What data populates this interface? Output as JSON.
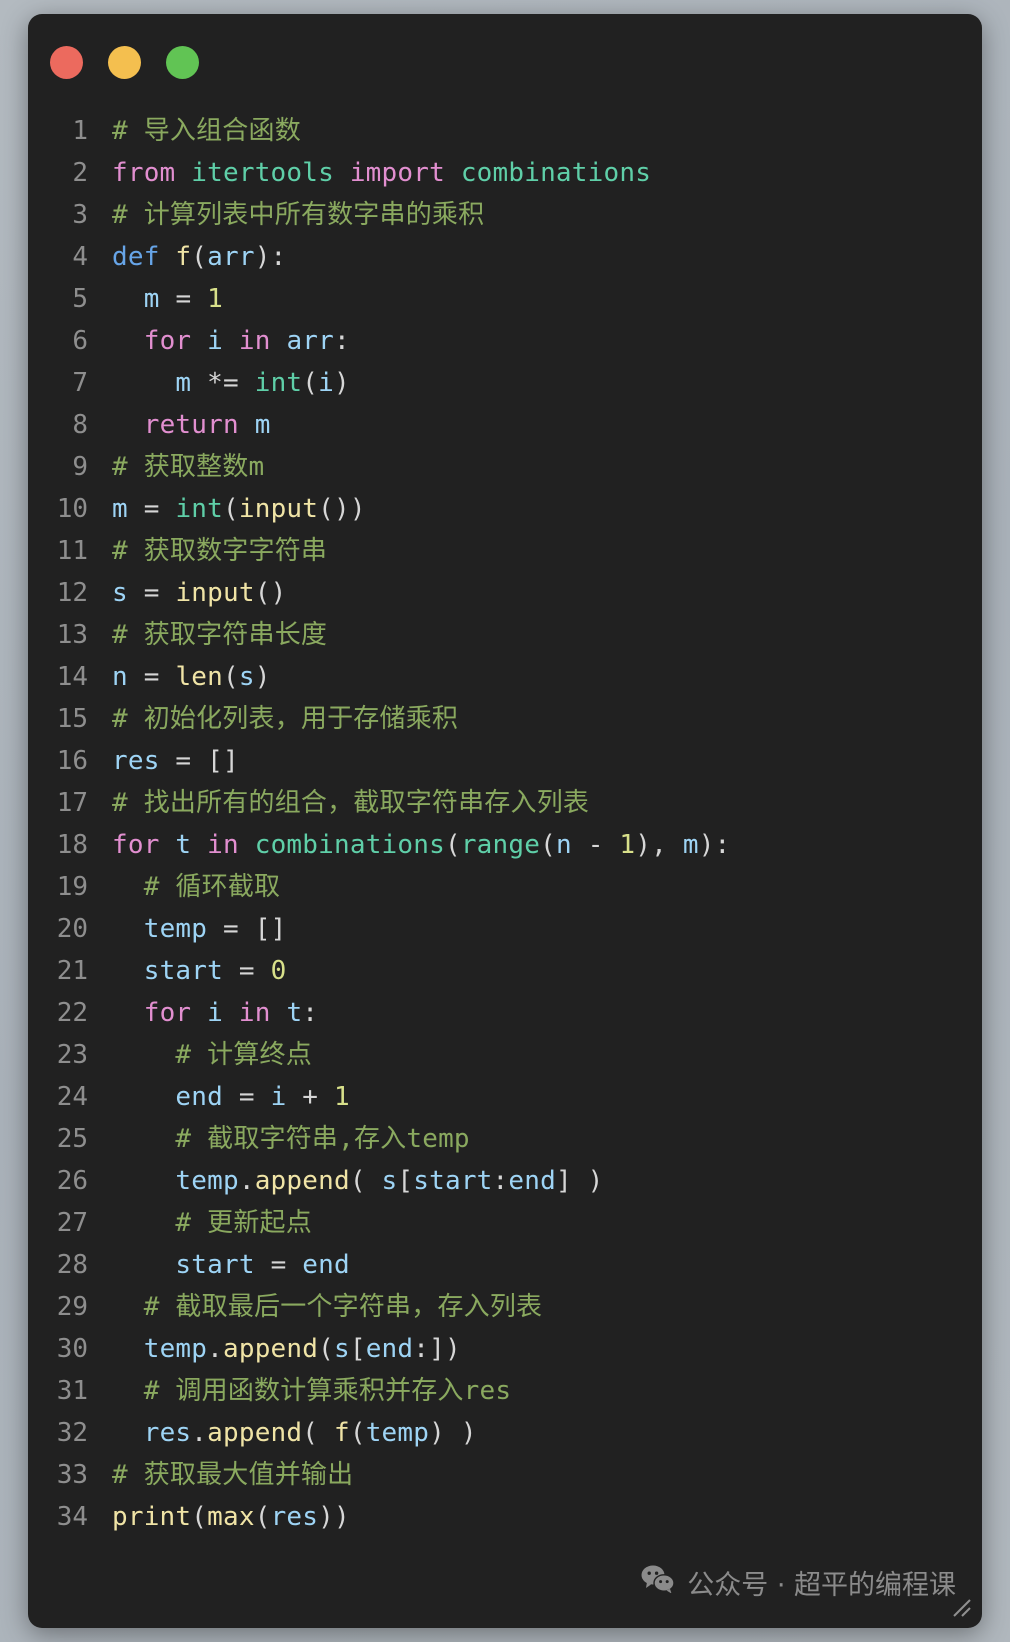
{
  "window": {
    "traffic_lights": [
      {
        "name": "close",
        "color": "#ec6a5e"
      },
      {
        "name": "minimize",
        "color": "#f4bf4f"
      },
      {
        "name": "maximize",
        "color": "#61c454"
      }
    ]
  },
  "editor": {
    "language": "python",
    "background": "#212121",
    "gutter_color": "#8e8e8e",
    "lines": [
      {
        "n": "1",
        "tokens": [
          {
            "t": "# 导入组合函数",
            "c": "t-com"
          }
        ]
      },
      {
        "n": "2",
        "tokens": [
          {
            "t": "from",
            "c": "t-kw"
          },
          {
            "t": " ",
            "c": "t-pun"
          },
          {
            "t": "itertools",
            "c": "t-mod"
          },
          {
            "t": " ",
            "c": "t-pun"
          },
          {
            "t": "import",
            "c": "t-kw"
          },
          {
            "t": " ",
            "c": "t-pun"
          },
          {
            "t": "combinations",
            "c": "t-mod"
          }
        ]
      },
      {
        "n": "3",
        "tokens": [
          {
            "t": "# 计算列表中所有数字串的乘积",
            "c": "t-com"
          }
        ]
      },
      {
        "n": "4",
        "tokens": [
          {
            "t": "def",
            "c": "t-def"
          },
          {
            "t": " ",
            "c": "t-pun"
          },
          {
            "t": "f",
            "c": "t-fn"
          },
          {
            "t": "(",
            "c": "t-pun"
          },
          {
            "t": "arr",
            "c": "t-var"
          },
          {
            "t": "):",
            "c": "t-pun"
          }
        ]
      },
      {
        "n": "5",
        "tokens": [
          {
            "t": "  ",
            "c": "t-pun"
          },
          {
            "t": "m",
            "c": "t-var"
          },
          {
            "t": " ",
            "c": "t-pun"
          },
          {
            "t": "=",
            "c": "t-op"
          },
          {
            "t": " ",
            "c": "t-pun"
          },
          {
            "t": "1",
            "c": "t-num"
          }
        ]
      },
      {
        "n": "6",
        "tokens": [
          {
            "t": "  ",
            "c": "t-pun"
          },
          {
            "t": "for",
            "c": "t-kw"
          },
          {
            "t": " ",
            "c": "t-pun"
          },
          {
            "t": "i",
            "c": "t-var"
          },
          {
            "t": " ",
            "c": "t-pun"
          },
          {
            "t": "in",
            "c": "t-kw"
          },
          {
            "t": " ",
            "c": "t-pun"
          },
          {
            "t": "arr",
            "c": "t-var"
          },
          {
            "t": ":",
            "c": "t-pun"
          }
        ]
      },
      {
        "n": "7",
        "tokens": [
          {
            "t": "    ",
            "c": "t-pun"
          },
          {
            "t": "m",
            "c": "t-var"
          },
          {
            "t": " ",
            "c": "t-pun"
          },
          {
            "t": "*=",
            "c": "t-op"
          },
          {
            "t": " ",
            "c": "t-pun"
          },
          {
            "t": "int",
            "c": "t-bif"
          },
          {
            "t": "(",
            "c": "t-pun"
          },
          {
            "t": "i",
            "c": "t-var"
          },
          {
            "t": ")",
            "c": "t-pun"
          }
        ]
      },
      {
        "n": "8",
        "tokens": [
          {
            "t": "  ",
            "c": "t-pun"
          },
          {
            "t": "return",
            "c": "t-kw"
          },
          {
            "t": " ",
            "c": "t-pun"
          },
          {
            "t": "m",
            "c": "t-var"
          }
        ]
      },
      {
        "n": "9",
        "tokens": [
          {
            "t": "# 获取整数m",
            "c": "t-com"
          }
        ]
      },
      {
        "n": "10",
        "tokens": [
          {
            "t": "m",
            "c": "t-var"
          },
          {
            "t": " ",
            "c": "t-pun"
          },
          {
            "t": "=",
            "c": "t-op"
          },
          {
            "t": " ",
            "c": "t-pun"
          },
          {
            "t": "int",
            "c": "t-bif"
          },
          {
            "t": "(",
            "c": "t-pun"
          },
          {
            "t": "input",
            "c": "t-fn"
          },
          {
            "t": "())",
            "c": "t-pun"
          }
        ]
      },
      {
        "n": "11",
        "tokens": [
          {
            "t": "# 获取数字字符串",
            "c": "t-com"
          }
        ]
      },
      {
        "n": "12",
        "tokens": [
          {
            "t": "s",
            "c": "t-var"
          },
          {
            "t": " ",
            "c": "t-pun"
          },
          {
            "t": "=",
            "c": "t-op"
          },
          {
            "t": " ",
            "c": "t-pun"
          },
          {
            "t": "input",
            "c": "t-fn"
          },
          {
            "t": "()",
            "c": "t-pun"
          }
        ]
      },
      {
        "n": "13",
        "tokens": [
          {
            "t": "# 获取字符串长度",
            "c": "t-com"
          }
        ]
      },
      {
        "n": "14",
        "tokens": [
          {
            "t": "n",
            "c": "t-var"
          },
          {
            "t": " ",
            "c": "t-pun"
          },
          {
            "t": "=",
            "c": "t-op"
          },
          {
            "t": " ",
            "c": "t-pun"
          },
          {
            "t": "len",
            "c": "t-fn"
          },
          {
            "t": "(",
            "c": "t-pun"
          },
          {
            "t": "s",
            "c": "t-var"
          },
          {
            "t": ")",
            "c": "t-pun"
          }
        ]
      },
      {
        "n": "15",
        "tokens": [
          {
            "t": "# 初始化列表，用于存储乘积",
            "c": "t-com"
          }
        ]
      },
      {
        "n": "16",
        "tokens": [
          {
            "t": "res",
            "c": "t-var"
          },
          {
            "t": " ",
            "c": "t-pun"
          },
          {
            "t": "=",
            "c": "t-op"
          },
          {
            "t": " ",
            "c": "t-pun"
          },
          {
            "t": "[]",
            "c": "t-pun"
          }
        ]
      },
      {
        "n": "17",
        "tokens": [
          {
            "t": "# 找出所有的组合，截取字符串存入列表",
            "c": "t-com"
          }
        ]
      },
      {
        "n": "18",
        "tokens": [
          {
            "t": "for",
            "c": "t-kw"
          },
          {
            "t": " ",
            "c": "t-pun"
          },
          {
            "t": "t",
            "c": "t-var"
          },
          {
            "t": " ",
            "c": "t-pun"
          },
          {
            "t": "in",
            "c": "t-kw"
          },
          {
            "t": " ",
            "c": "t-pun"
          },
          {
            "t": "combinations",
            "c": "t-mod"
          },
          {
            "t": "(",
            "c": "t-pun"
          },
          {
            "t": "range",
            "c": "t-bif"
          },
          {
            "t": "(",
            "c": "t-pun"
          },
          {
            "t": "n",
            "c": "t-var"
          },
          {
            "t": " ",
            "c": "t-pun"
          },
          {
            "t": "-",
            "c": "t-op"
          },
          {
            "t": " ",
            "c": "t-pun"
          },
          {
            "t": "1",
            "c": "t-num"
          },
          {
            "t": "), ",
            "c": "t-pun"
          },
          {
            "t": "m",
            "c": "t-var"
          },
          {
            "t": "):",
            "c": "t-pun"
          }
        ]
      },
      {
        "n": "19",
        "tokens": [
          {
            "t": "  # 循环截取",
            "c": "t-com"
          }
        ]
      },
      {
        "n": "20",
        "tokens": [
          {
            "t": "  ",
            "c": "t-pun"
          },
          {
            "t": "temp",
            "c": "t-var"
          },
          {
            "t": " ",
            "c": "t-pun"
          },
          {
            "t": "=",
            "c": "t-op"
          },
          {
            "t": " ",
            "c": "t-pun"
          },
          {
            "t": "[]",
            "c": "t-pun"
          }
        ]
      },
      {
        "n": "21",
        "tokens": [
          {
            "t": "  ",
            "c": "t-pun"
          },
          {
            "t": "start",
            "c": "t-var"
          },
          {
            "t": " ",
            "c": "t-pun"
          },
          {
            "t": "=",
            "c": "t-op"
          },
          {
            "t": " ",
            "c": "t-pun"
          },
          {
            "t": "0",
            "c": "t-num"
          }
        ]
      },
      {
        "n": "22",
        "tokens": [
          {
            "t": "  ",
            "c": "t-pun"
          },
          {
            "t": "for",
            "c": "t-kw"
          },
          {
            "t": " ",
            "c": "t-pun"
          },
          {
            "t": "i",
            "c": "t-var"
          },
          {
            "t": " ",
            "c": "t-pun"
          },
          {
            "t": "in",
            "c": "t-kw"
          },
          {
            "t": " ",
            "c": "t-pun"
          },
          {
            "t": "t",
            "c": "t-var"
          },
          {
            "t": ":",
            "c": "t-pun"
          }
        ]
      },
      {
        "n": "23",
        "tokens": [
          {
            "t": "    # 计算终点",
            "c": "t-com"
          }
        ]
      },
      {
        "n": "24",
        "tokens": [
          {
            "t": "    ",
            "c": "t-pun"
          },
          {
            "t": "end",
            "c": "t-var"
          },
          {
            "t": " ",
            "c": "t-pun"
          },
          {
            "t": "=",
            "c": "t-op"
          },
          {
            "t": " ",
            "c": "t-pun"
          },
          {
            "t": "i",
            "c": "t-var"
          },
          {
            "t": " ",
            "c": "t-pun"
          },
          {
            "t": "+",
            "c": "t-op"
          },
          {
            "t": " ",
            "c": "t-pun"
          },
          {
            "t": "1",
            "c": "t-num"
          }
        ]
      },
      {
        "n": "25",
        "tokens": [
          {
            "t": "    # 截取字符串,存入temp",
            "c": "t-com"
          }
        ]
      },
      {
        "n": "26",
        "tokens": [
          {
            "t": "    ",
            "c": "t-pun"
          },
          {
            "t": "temp",
            "c": "t-var"
          },
          {
            "t": ".",
            "c": "t-pun"
          },
          {
            "t": "append",
            "c": "t-fn"
          },
          {
            "t": "( ",
            "c": "t-pun"
          },
          {
            "t": "s",
            "c": "t-var"
          },
          {
            "t": "[",
            "c": "t-pun"
          },
          {
            "t": "start",
            "c": "t-var"
          },
          {
            "t": ":",
            "c": "t-pun"
          },
          {
            "t": "end",
            "c": "t-var"
          },
          {
            "t": "] )",
            "c": "t-pun"
          }
        ]
      },
      {
        "n": "27",
        "tokens": [
          {
            "t": "    # 更新起点",
            "c": "t-com"
          }
        ]
      },
      {
        "n": "28",
        "tokens": [
          {
            "t": "    ",
            "c": "t-pun"
          },
          {
            "t": "start",
            "c": "t-var"
          },
          {
            "t": " ",
            "c": "t-pun"
          },
          {
            "t": "=",
            "c": "t-op"
          },
          {
            "t": " ",
            "c": "t-pun"
          },
          {
            "t": "end",
            "c": "t-var"
          }
        ]
      },
      {
        "n": "29",
        "tokens": [
          {
            "t": "  # 截取最后一个字符串，存入列表",
            "c": "t-com"
          }
        ]
      },
      {
        "n": "30",
        "tokens": [
          {
            "t": "  ",
            "c": "t-pun"
          },
          {
            "t": "temp",
            "c": "t-var"
          },
          {
            "t": ".",
            "c": "t-pun"
          },
          {
            "t": "append",
            "c": "t-fn"
          },
          {
            "t": "(",
            "c": "t-pun"
          },
          {
            "t": "s",
            "c": "t-var"
          },
          {
            "t": "[",
            "c": "t-pun"
          },
          {
            "t": "end",
            "c": "t-var"
          },
          {
            "t": ":])",
            "c": "t-pun"
          }
        ]
      },
      {
        "n": "31",
        "tokens": [
          {
            "t": "  # 调用函数计算乘积并存入res",
            "c": "t-com"
          }
        ]
      },
      {
        "n": "32",
        "tokens": [
          {
            "t": "  ",
            "c": "t-pun"
          },
          {
            "t": "res",
            "c": "t-var"
          },
          {
            "t": ".",
            "c": "t-pun"
          },
          {
            "t": "append",
            "c": "t-fn"
          },
          {
            "t": "( ",
            "c": "t-pun"
          },
          {
            "t": "f",
            "c": "t-fn"
          },
          {
            "t": "(",
            "c": "t-pun"
          },
          {
            "t": "temp",
            "c": "t-var"
          },
          {
            "t": ") )",
            "c": "t-pun"
          }
        ]
      },
      {
        "n": "33",
        "tokens": [
          {
            "t": "# 获取最大值并输出",
            "c": "t-com"
          }
        ]
      },
      {
        "n": "34",
        "tokens": [
          {
            "t": "print",
            "c": "t-fn"
          },
          {
            "t": "(",
            "c": "t-pun"
          },
          {
            "t": "max",
            "c": "t-fn"
          },
          {
            "t": "(",
            "c": "t-pun"
          },
          {
            "t": "res",
            "c": "t-var"
          },
          {
            "t": "))",
            "c": "t-pun"
          }
        ]
      }
    ]
  },
  "watermark": {
    "icon": "wechat-icon",
    "text": "公众号 · 超平的编程课"
  }
}
